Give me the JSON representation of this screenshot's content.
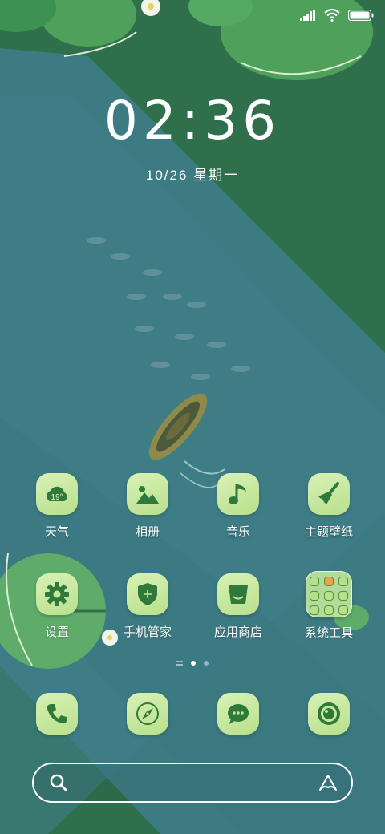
{
  "status_bar": {
    "signal_icon": "signal-icon",
    "wifi_icon": "wifi-icon",
    "battery_icon": "battery-icon",
    "battery_level": 1.0
  },
  "lockclock": {
    "time": "02:36",
    "date": "10/26  星期一"
  },
  "apps": [
    {
      "label": "天气",
      "icon": "weather-icon",
      "temp": "19°"
    },
    {
      "label": "相册",
      "icon": "gallery-icon"
    },
    {
      "label": "音乐",
      "icon": "music-icon"
    },
    {
      "label": "主题壁纸",
      "icon": "theme-brush-icon"
    },
    {
      "label": "设置",
      "icon": "gear-icon"
    },
    {
      "label": "手机管家",
      "icon": "shield-icon"
    },
    {
      "label": "应用商店",
      "icon": "store-bag-icon"
    },
    {
      "label": "系统工具",
      "icon": "folder-icon"
    }
  ],
  "page_indicator": {
    "pages": 2,
    "current": 1
  },
  "dock": [
    {
      "icon": "phone-icon"
    },
    {
      "icon": "compass-icon"
    },
    {
      "icon": "message-icon"
    },
    {
      "icon": "camera-icon"
    }
  ],
  "search_bar": {
    "search_icon": "search-icon",
    "assistant_icon": "assistant-icon"
  },
  "colors": {
    "tile": "#c6e79a",
    "icon": "#2f7a3a",
    "water": "#3f7f86",
    "grass": "#2f6f4c"
  }
}
